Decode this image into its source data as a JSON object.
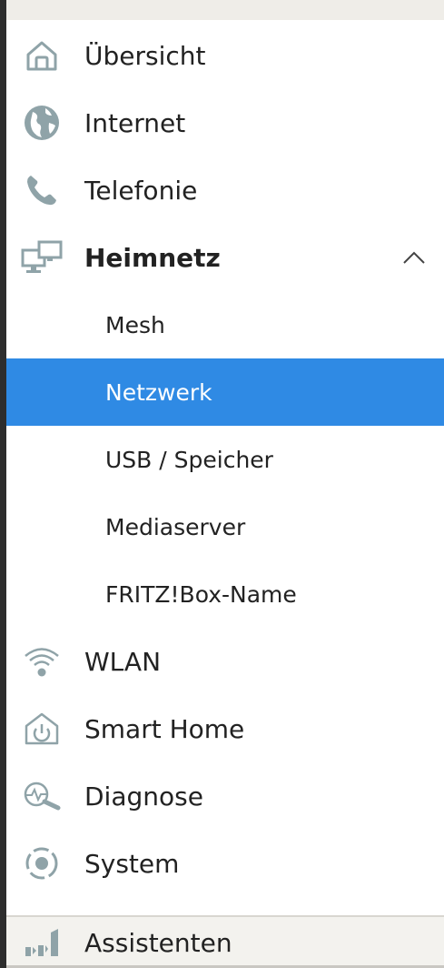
{
  "nav": {
    "uebersicht": "Übersicht",
    "internet": "Internet",
    "telefonie": "Telefonie",
    "heimnetz": "Heimnetz",
    "heimnetz_sub": {
      "mesh": "Mesh",
      "netzwerk": "Netzwerk",
      "usb": "USB / Speicher",
      "mediaserver": "Mediaserver",
      "fritzbox_name": "FRITZ!Box-Name"
    },
    "wlan": "WLAN",
    "smart_home": "Smart Home",
    "diagnose": "Diagnose",
    "system": "System"
  },
  "footer": {
    "assistenten": "Assistenten"
  },
  "icons": {
    "uebersicht": "home-icon",
    "internet": "globe-icon",
    "telefonie": "phone-icon",
    "heimnetz": "network-computers-icon",
    "heimnetz_toggle": "chevron-up-icon",
    "wlan": "wifi-icon",
    "smart_home": "smart-home-power-icon",
    "diagnose": "diagnose-magnifier-icon",
    "system": "system-dot-icon",
    "assistenten": "assistant-signal-icon"
  },
  "colors": {
    "accent": "#2f8ae4",
    "icon": "#8fa3a8",
    "text": "#222222"
  }
}
